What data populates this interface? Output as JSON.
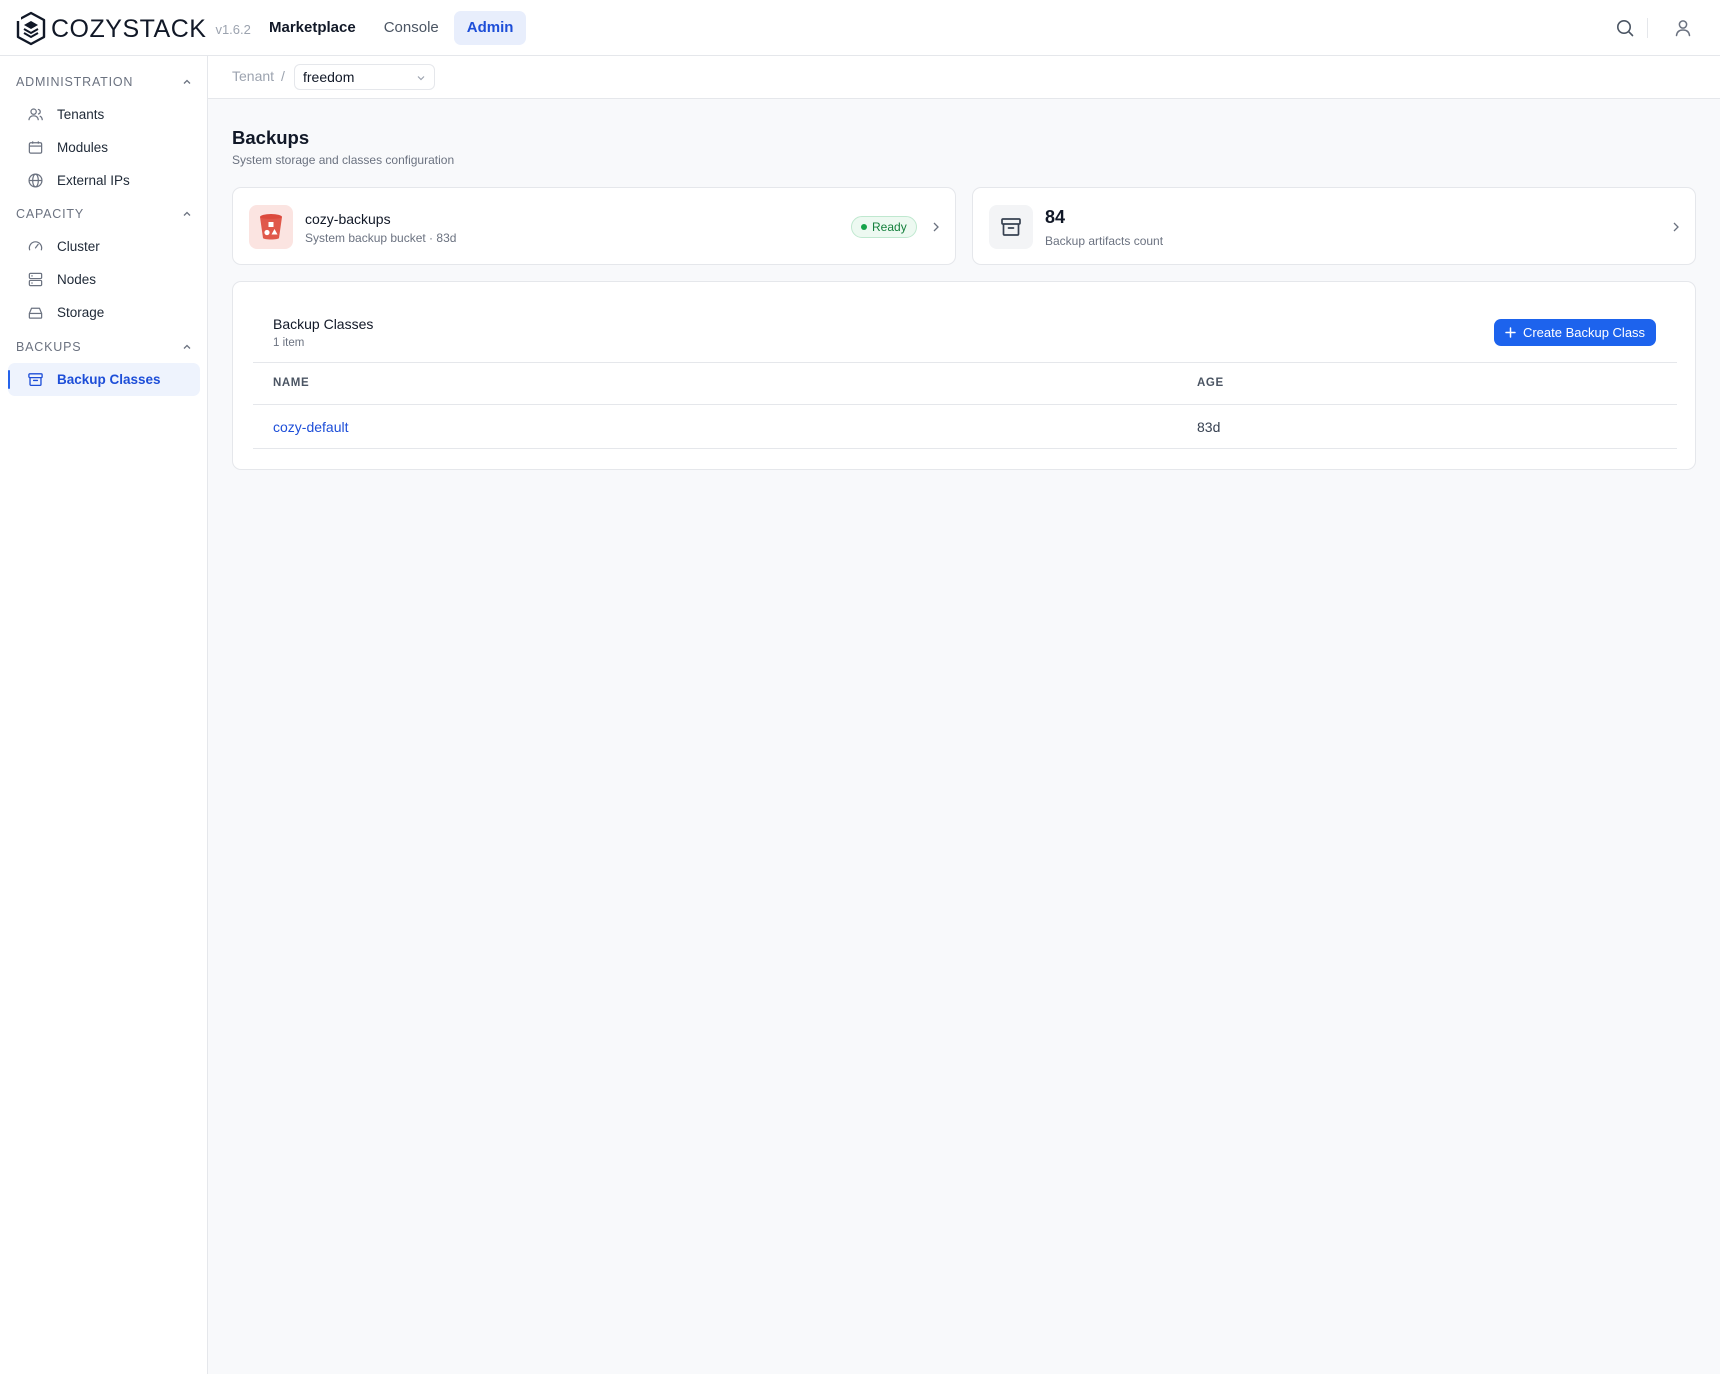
{
  "app": {
    "brand": "COZYSTACK",
    "version": "v1.6.2"
  },
  "topnav": {
    "items": [
      "Marketplace",
      "Console",
      "Admin"
    ],
    "active": "Admin"
  },
  "sidebar": {
    "sections": [
      {
        "title": "ADMINISTRATION",
        "items": [
          {
            "label": "Tenants",
            "icon": "users-icon"
          },
          {
            "label": "Modules",
            "icon": "calendar-icon"
          },
          {
            "label": "External IPs",
            "icon": "globe-icon"
          }
        ]
      },
      {
        "title": "CAPACITY",
        "items": [
          {
            "label": "Cluster",
            "icon": "gauge-icon"
          },
          {
            "label": "Nodes",
            "icon": "server-icon"
          },
          {
            "label": "Storage",
            "icon": "hard-drive-icon"
          }
        ]
      },
      {
        "title": "BACKUPS",
        "items": [
          {
            "label": "Backup Classes",
            "icon": "archive-icon",
            "active": true
          }
        ]
      }
    ]
  },
  "breadcrumb": {
    "tenant_label": "Tenant",
    "separator": "/",
    "tenant_value": "freedom"
  },
  "page": {
    "title": "Backups",
    "subtitle": "System storage and classes configuration"
  },
  "bucket_card": {
    "name": "cozy-backups",
    "subtitle": "System backup bucket · 83d",
    "status": "Ready",
    "status_color": "#16a34a",
    "icon": "bucket-icon"
  },
  "artifacts_card": {
    "count": "84",
    "label": "Backup artifacts count",
    "icon": "archive-icon"
  },
  "backup_classes": {
    "title": "Backup Classes",
    "count_label": "1 item",
    "create_button": "Create Backup Class",
    "columns": [
      "NAME",
      "AGE"
    ],
    "rows": [
      {
        "name": "cozy-default",
        "age": "83d"
      }
    ]
  },
  "colors": {
    "accent": "#1d63ed",
    "link": "#1d4ed8",
    "active_nav_bg": "#e8eefc"
  }
}
